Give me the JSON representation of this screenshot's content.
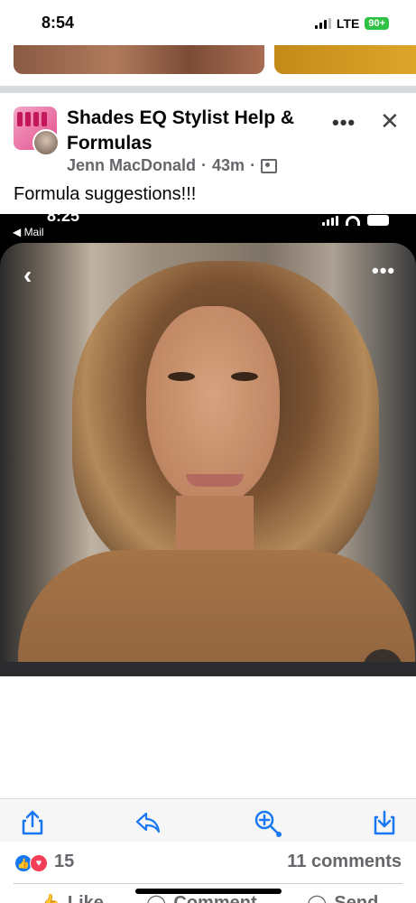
{
  "status_bar": {
    "time": "8:54",
    "network": "LTE",
    "battery": "90+"
  },
  "post": {
    "group_name": "Shades EQ Stylist Help & Formulas",
    "author": "Jenn MacDonald",
    "time_ago": "43m",
    "separator": "·",
    "text": "Formula suggestions!!!",
    "more_icon": "more-horizontal-icon",
    "close_icon": "close-icon"
  },
  "embedded_screenshot": {
    "time": "8:25",
    "back_label": "◀ Mail",
    "back_icon": "chevron-left-icon",
    "more_icon": "more-horizontal-icon",
    "live_text_icon": "live-text-icon"
  },
  "toolbar": {
    "items": [
      {
        "icon": "share-icon"
      },
      {
        "icon": "reply-icon"
      },
      {
        "icon": "zoom-in-icon"
      },
      {
        "icon": "download-icon"
      }
    ],
    "accent": "#1877f2"
  },
  "reactions": {
    "count": "15",
    "comments": "11 comments"
  },
  "actions": {
    "like": "Like",
    "comment": "Comment",
    "send": "Send"
  }
}
